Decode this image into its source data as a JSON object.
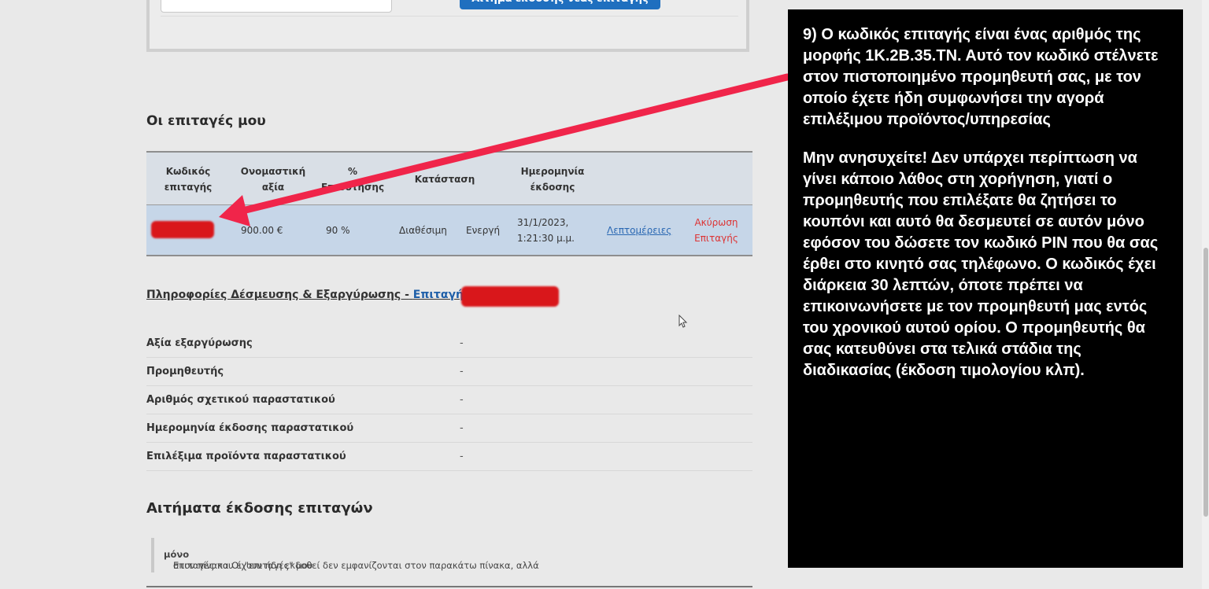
{
  "top_form": {
    "button_label": "Αίτημα έκδοσης νέας επιταγής"
  },
  "my_vouchers": {
    "heading": "Οι επιταγές μου",
    "columns": [
      [
        "Κωδικός",
        "επιταγής"
      ],
      [
        "Ονομαστική",
        "αξία"
      ],
      [
        "%",
        "Επιδότησης"
      ],
      [
        "Κατάσταση"
      ],
      [
        "Ημερομηνία",
        "έκδοσης"
      ]
    ],
    "row": {
      "code": "",
      "value": "900.00 €",
      "percent": "90 %",
      "status1": "Διαθέσιμη",
      "status2": "Ενεργή",
      "date_line1": "31/1/2023,",
      "date_line2": "1:21:30 μ.μ.",
      "details_link": "Λεπτομέρειες",
      "cancel_line1": "Ακύρωση",
      "cancel_line2": "Επιταγής"
    }
  },
  "binding_info": {
    "title": "Πληροφορίες Δέσμευσης & Εξαργύρωσης -",
    "title_link": "Επιταγή",
    "rows": [
      {
        "label": "Αξία εξαργύρωσης",
        "value": "-"
      },
      {
        "label": "Προμηθευτής",
        "value": "-"
      },
      {
        "label": "Αριθμός σχετικού παραστατικού",
        "value": "-"
      },
      {
        "label": "Ημερομηνία έκδοσης παραστατικού",
        "value": "-"
      },
      {
        "label": "Επιλέξιμα προϊόντα παραστατικού",
        "value": "-"
      }
    ]
  },
  "requests": {
    "heading": "Αιτήματα έκδοσης επιταγών",
    "note_pre": "Επιταγές που έχουν ήδη εκδοθεί δεν εμφανίζονται στον παρακάτω πίνακα, αλλά ",
    "note_bold": "μόνο",
    "note_post": " στον πίνακα Οι \"επιταγές\" μου"
  },
  "overlay": {
    "paragraph1": "9) Ο κωδικός επιταγής είναι ένας αριθμός της μορφής 1Κ.2Β.35.ΤΝ. Αυτό τον κωδικό στέλνετε στον πιστοποιημένο προμηθευτή σας, με τον οποίο έχετε ήδη συμφωνήσει την αγορά επιλέξιμου προϊόντος/υπηρεσίας",
    "paragraph2": "Μην ανησυχείτε! Δεν υπάρχει περίπτωση να γίνει κάποιο λάθος στη χορήγηση, γιατί ο προμηθευτής που επιλέξατε θα ζητήσει το κουπόνι και αυτό θα δεσμευτεί σε αυτόν μόνο εφόσον του δώσετε τον κωδικό PIN που θα σας έρθει στο κινητό σας τηλέφωνο. Ο κωδικός έχει διάρκεια 30 λεπτών, όποτε πρέπει να επικοινωνήσετε με τον προμηθευτή μας εντός του χρονικού αυτού ορίου. Ο προμηθευτής θα σας κατευθύνει στα τελικά στάδια της διαδικασίας (έκδοση τιμολογίου κλπ)."
  },
  "colors": {
    "arrow": "#f0254a",
    "accent": "#1f6fbf",
    "cancel": "#dd3333"
  }
}
